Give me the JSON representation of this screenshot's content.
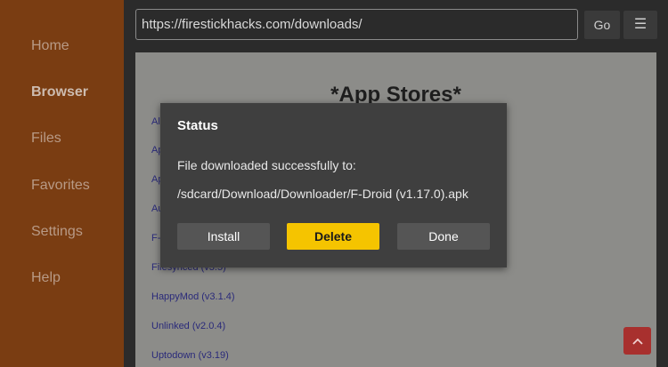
{
  "sidebar": {
    "items": [
      {
        "label": "Home"
      },
      {
        "label": "Browser"
      },
      {
        "label": "Files"
      },
      {
        "label": "Favorites"
      },
      {
        "label": "Settings"
      },
      {
        "label": "Help"
      }
    ],
    "active": "Browser"
  },
  "topbar": {
    "url": "https://firestickhacks.com/downloads/",
    "go_label": "Go",
    "menu_glyph": "☰"
  },
  "webpage": {
    "title": "*App Stores*",
    "links": [
      {
        "text": "Al"
      },
      {
        "text": "Ap"
      },
      {
        "text": "Ap"
      },
      {
        "text": "Au"
      },
      {
        "text": "F-"
      },
      {
        "text": "Filesynced (v3.5)"
      },
      {
        "text": "HappyMod (v3.1.4)"
      },
      {
        "text": "Unlinked (v2.0.4)"
      },
      {
        "text": "Uptodown (v3.19)"
      }
    ],
    "fab_icon": "chevron-up-icon"
  },
  "dialog": {
    "title": "Status",
    "message": "File downloaded successfully to:",
    "path": "/sdcard/Download/Downloader/F-Droid (v1.17.0).apk",
    "buttons": {
      "install": "Install",
      "delete": "Delete",
      "done": "Done"
    }
  },
  "colors": {
    "sidebar": "#7a3d12",
    "accent": "#f5c400",
    "dialog_bg": "#3f3f3f"
  }
}
